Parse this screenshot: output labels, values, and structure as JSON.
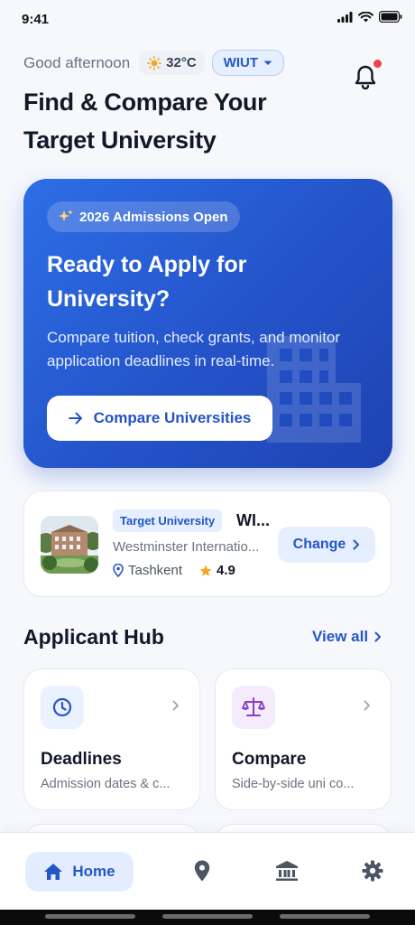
{
  "status_bar": {
    "time": "9:41"
  },
  "header": {
    "greeting": "Good afternoon",
    "temperature": "32°C",
    "university_chip": "WIUT",
    "title": "Find & Compare Your Target University",
    "notification_dot": true
  },
  "hero": {
    "badge": "2026 Admissions Open",
    "title": "Ready to Apply for University?",
    "description": "Compare tuition, check grants, and monitor application deadlines in real-time.",
    "button_label": "Compare Universities"
  },
  "target_university": {
    "tag": "Target University",
    "abbreviation": "WI...",
    "name": "Westminster Internatio...",
    "location": "Tashkent",
    "rating": "4.9",
    "change_label": "Change"
  },
  "hub": {
    "title": "Applicant Hub",
    "view_all": "View all",
    "cards": [
      {
        "title": "Deadlines",
        "subtitle": "Admission dates & c...",
        "icon": "clock-icon"
      },
      {
        "title": "Compare",
        "subtitle": "Side-by-side uni co...",
        "icon": "scale-icon"
      }
    ]
  },
  "bottom_nav": {
    "items": [
      {
        "label": "Home",
        "icon": "home-icon",
        "active": true
      },
      {
        "label": "",
        "icon": "location-icon",
        "active": false
      },
      {
        "label": "",
        "icon": "university-icon",
        "active": false
      },
      {
        "label": "",
        "icon": "settings-icon",
        "active": false
      }
    ]
  },
  "colors": {
    "accent": "#2457c5",
    "hero_start": "#2d6ee6",
    "hero_end": "#1e43b3",
    "accent_soft": "#e6efff",
    "notification": "#ef4444",
    "star": "#f5a623"
  }
}
